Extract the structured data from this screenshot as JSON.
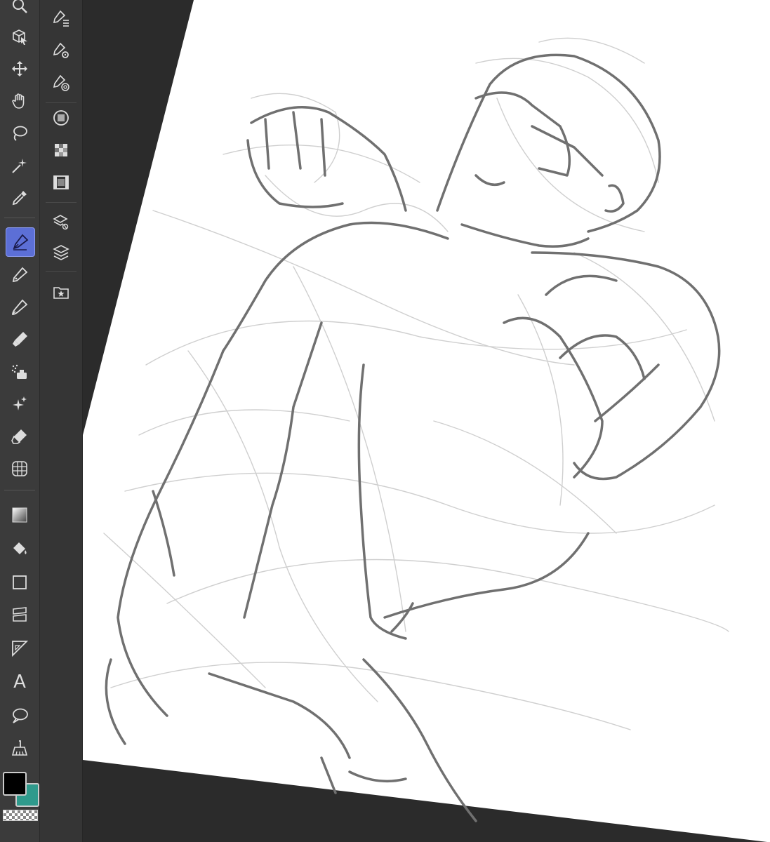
{
  "app": {
    "name": "Drawing canvas"
  },
  "tools": [
    {
      "name": "zoom-icon",
      "active": false
    },
    {
      "name": "operation-icon",
      "active": false
    },
    {
      "name": "move-layer-icon",
      "active": false
    },
    {
      "name": "hand-icon",
      "active": false
    },
    {
      "name": "lasso-icon",
      "active": false
    },
    {
      "name": "magic-wand-icon",
      "active": false
    },
    {
      "name": "eyedropper-icon",
      "active": false
    },
    {
      "name": "pen-icon",
      "active": true
    },
    {
      "name": "pencil-icon",
      "active": false
    },
    {
      "name": "brush-icon",
      "active": false
    },
    {
      "name": "marker-icon",
      "active": false
    },
    {
      "name": "airbrush-icon",
      "active": false
    },
    {
      "name": "decoration-icon",
      "active": false
    },
    {
      "name": "eraser-icon",
      "active": false
    },
    {
      "name": "blend-icon",
      "active": false
    },
    {
      "name": "gradient-icon",
      "active": false
    },
    {
      "name": "fill-icon",
      "active": false
    },
    {
      "name": "figure-icon",
      "active": false
    },
    {
      "name": "frame-border-icon",
      "active": false
    },
    {
      "name": "ruler-icon",
      "active": false
    },
    {
      "name": "text-icon",
      "active": false
    },
    {
      "name": "balloon-icon",
      "active": false
    },
    {
      "name": "correct-line-icon",
      "active": false
    }
  ],
  "sub_tools": [
    {
      "name": "sub-tool-list-icon"
    },
    {
      "name": "tool-property-icon"
    },
    {
      "name": "brush-size-icon"
    },
    {
      "name": "color-circle-icon"
    },
    {
      "name": "color-set-icon"
    },
    {
      "name": "animation-timeline-icon"
    },
    {
      "name": "layer-property-icon"
    },
    {
      "name": "layers-icon"
    },
    {
      "name": "material-icon"
    }
  ],
  "colors": {
    "main": "#000000",
    "sub": "#2f9a8c",
    "accent": "#5c6fd6",
    "panel": "#3b3b3b"
  },
  "text_tool_glyph": "A"
}
